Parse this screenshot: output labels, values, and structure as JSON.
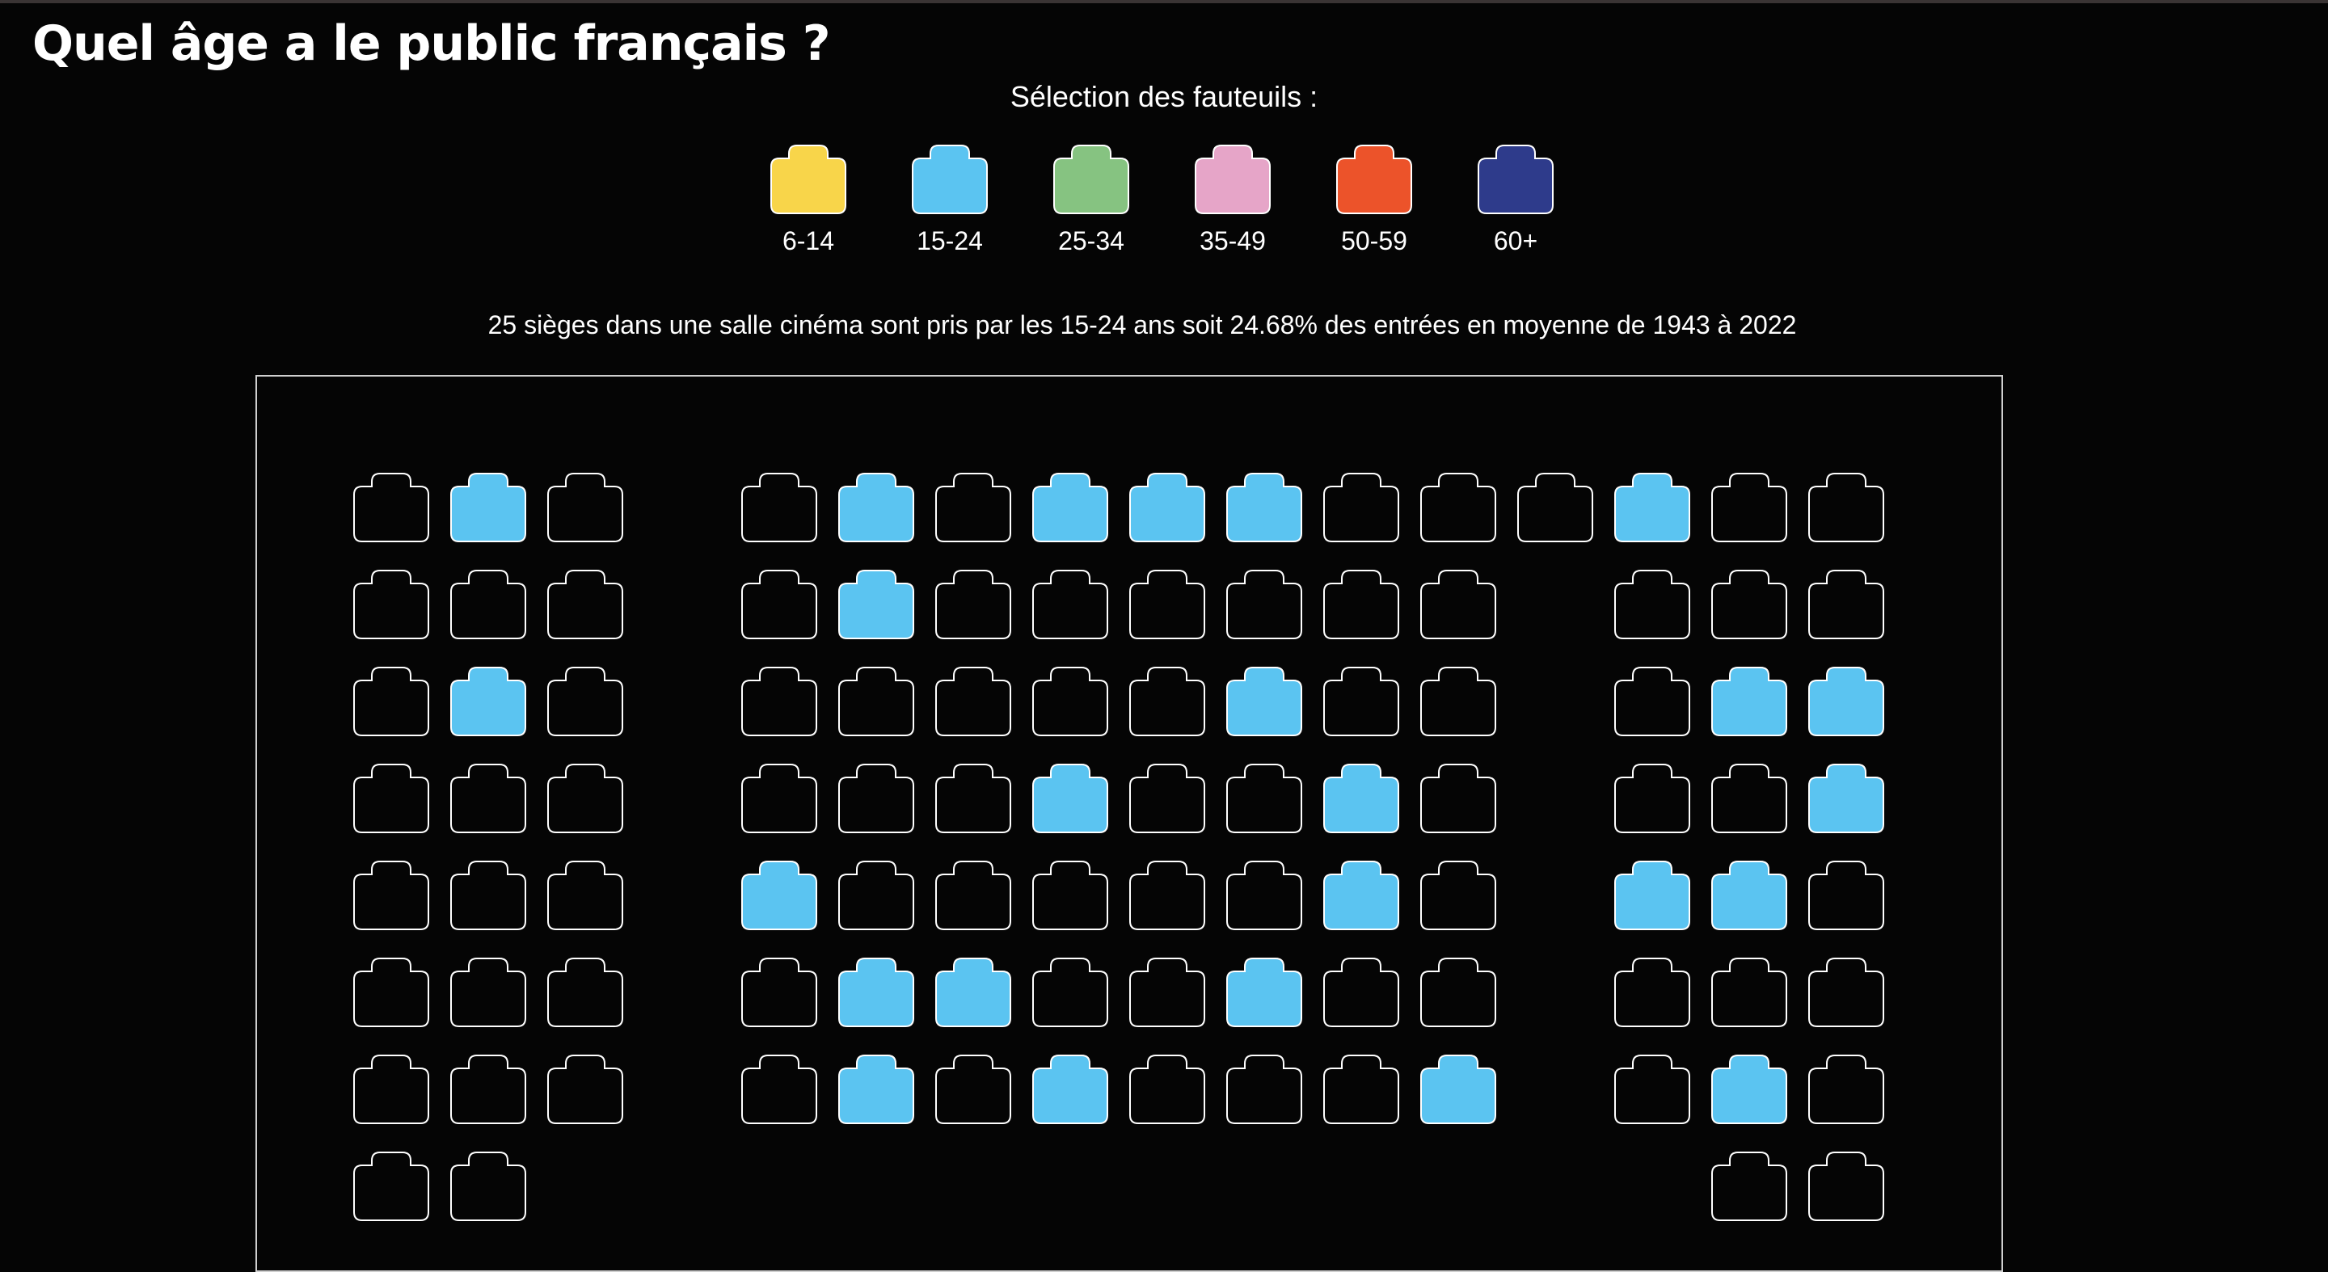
{
  "title": "Quel âge a le public français ?",
  "legend": {
    "title": "Sélection des fauteuils :",
    "items": [
      {
        "label": "6-14",
        "color": "#f8d54a"
      },
      {
        "label": "15-24",
        "color": "#5bc4f1"
      },
      {
        "label": "25-34",
        "color": "#86c381"
      },
      {
        "label": "35-49",
        "color": "#e6a5c8"
      },
      {
        "label": "50-59",
        "color": "#ec532a"
      },
      {
        "label": "60+",
        "color": "#2e3b8b"
      }
    ],
    "selected": "15-24"
  },
  "subtitle": "25 sièges dans une salle cinéma sont pris par les 15-24 ans soit 24.68% des entrées en moyenne de 1943 à 2022",
  "colors": {
    "background": "#050505",
    "seat_outline": "#ffffff",
    "highlight": "#5bc4f1",
    "title_accent": "#f8d54a"
  },
  "hall": {
    "rows": [
      "_X_ _X_XXX___X__",
      "___ _X______ ___",
      "_X_ _____X__ _XX",
      "___ ___X__X_ __X",
      "___ X_____X_ XX_",
      "___ _XX__X__ ___",
      "___ _X_X___X _X_",
      "__.          .__"
    ]
  }
}
